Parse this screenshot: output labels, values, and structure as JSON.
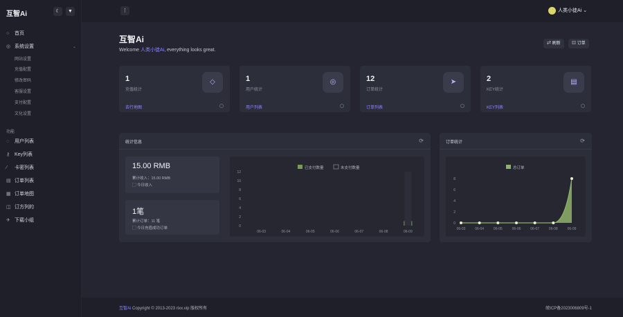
{
  "app": {
    "brand": "互智Ai",
    "theme_icon": "moon-icon",
    "pin_icon": "pin-icon",
    "menu_icon": "hamburger-icon"
  },
  "user": {
    "name": "人类小徒Ai",
    "chevron": "⌄"
  },
  "sidebar": {
    "items": [
      {
        "label": "首页",
        "icon": "○"
      },
      {
        "label": "系统设置",
        "icon": "◎",
        "chevron": "⌄"
      }
    ],
    "sub": [
      "网站设置",
      "充值配置",
      "修改密码",
      "客服设置",
      "支付配置",
      "文化设置"
    ],
    "section": "功能",
    "items2": [
      {
        "label": "用户列表",
        "icon": "◌"
      },
      {
        "label": "Key列表",
        "icon": "⚷"
      },
      {
        "label": "卡密列表",
        "icon": "⁄"
      },
      {
        "label": "订单列表",
        "icon": "▤"
      },
      {
        "label": "订单地图",
        "icon": "▦"
      },
      {
        "label": "订方列的",
        "icon": "◫"
      },
      {
        "label": "下载小组",
        "icon": "✈"
      }
    ]
  },
  "page": {
    "title": "互智Ai",
    "welcome_pre": "Welcome ",
    "welcome_user": "人类小徒Ai",
    "welcome_post": ", everything looks great.",
    "btn1": "刷新",
    "btn2": "订单"
  },
  "cards": [
    {
      "num": "1",
      "label": "充值统计",
      "link": "去行地图",
      "icon": "◇"
    },
    {
      "num": "1",
      "label": "用户统计",
      "link": "用户列表",
      "icon": "◎"
    },
    {
      "num": "12",
      "label": "订单统计",
      "link": "订单列表",
      "icon": "➤"
    },
    {
      "num": "2",
      "label": "KEY统计",
      "link": "KEY列表",
      "icon": "▤"
    }
  ],
  "stats_panel": {
    "title": "统计信息",
    "refresh": "⟳",
    "box1": {
      "big": "15.00 RMB",
      "l1": "累计收入：15.00 RMB",
      "l2": "今日收入"
    },
    "box2": {
      "big": "1笔",
      "l1": "累计订单：11 笔",
      "l2": "今日充值成功订单"
    }
  },
  "orders_panel": {
    "title": "订单统计",
    "refresh": "⟳"
  },
  "chart_data": [
    {
      "type": "bar",
      "categories": [
        "06-03",
        "06-04",
        "06-05",
        "06-06",
        "06-07",
        "06-08",
        "06-09"
      ],
      "series": [
        {
          "name": "已支付数量",
          "values": [
            0,
            0,
            0,
            0,
            0,
            0,
            1
          ]
        },
        {
          "name": "未支付数量",
          "values": [
            0,
            0,
            0,
            0,
            0,
            0,
            12
          ]
        }
      ],
      "yticks": [
        "0",
        "2",
        "4",
        "6",
        "8",
        "10",
        "12"
      ],
      "ylim": [
        0,
        12
      ],
      "colors": [
        "#7a9a5a",
        "#2c2e3a"
      ]
    },
    {
      "type": "area",
      "categories": [
        "06-03",
        "06-04",
        "06-05",
        "06-06",
        "06-07",
        "06-08",
        "06-09"
      ],
      "series": [
        {
          "name": "总订单",
          "values": [
            0,
            0,
            0,
            0,
            0,
            0,
            8
          ]
        }
      ],
      "yticks": [
        "0",
        "2",
        "4",
        "6",
        "8"
      ],
      "ylim": [
        0,
        8
      ],
      "color": "#8fb36a"
    }
  ],
  "footer": {
    "brand": "互智Ai",
    "copyright": " Copyright © 2013-2023 rixx.vip 版权所有",
    "icp": "皖ICP备2023006809号-1"
  }
}
